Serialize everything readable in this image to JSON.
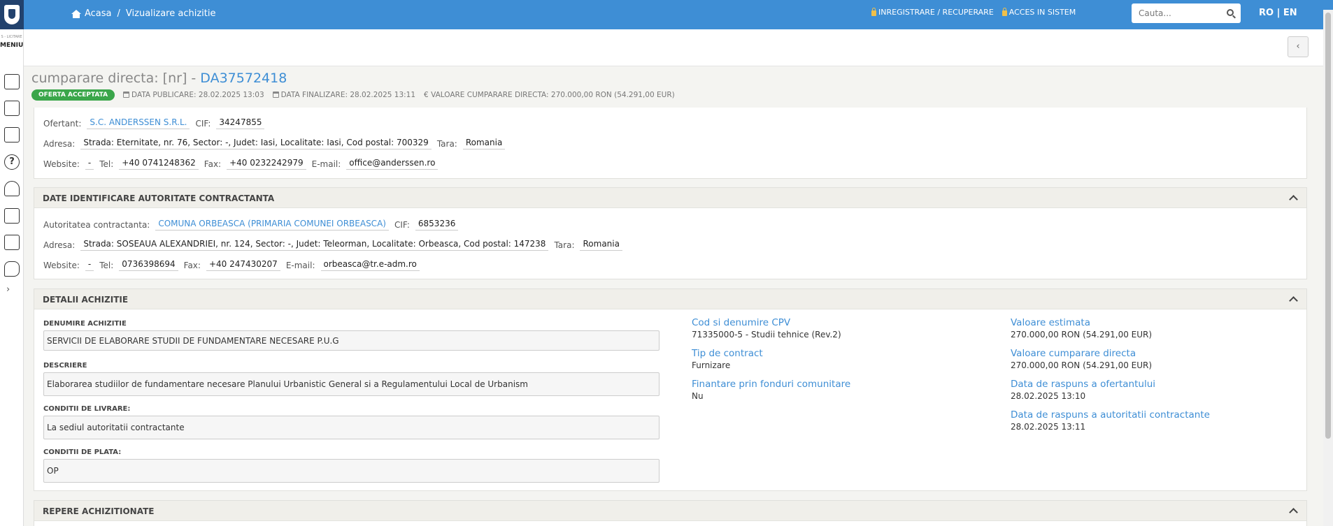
{
  "header": {
    "breadcrumb": {
      "home": "Acasa",
      "separator": "/",
      "current": "Vizualizare achizitie"
    },
    "links": {
      "register": "INREGISTRARE / RECUPERARE",
      "login": "ACCES IN SISTEM"
    },
    "search": {
      "placeholder": "Cauta..."
    },
    "lang": "RO | EN"
  },
  "sidebar": {
    "tiny_label": "S - LICITARE",
    "menu_label": "MENIU"
  },
  "title": {
    "prefix": "cumparare directa: [nr] - ",
    "code": "DA37572418"
  },
  "meta": {
    "badge": "OFERTA ACCEPTATA",
    "published": "DATA PUBLICARE: 28.02.2025 13:03",
    "finalized": "DATA FINALIZARE: 28.02.2025 13:11",
    "value": "€ VALOARE CUMPARARE DIRECTA: 270.000,00  RON (54.291,00  EUR)"
  },
  "ofertant": {
    "label": "Ofertant:",
    "name": "S.C. ANDERSSEN S.R.L.",
    "cif_label": "CIF:",
    "cif": "34247855",
    "address_label": "Adresa:",
    "address": "Strada: Eternitate, nr. 76, Sector: -, Judet: Iasi, Localitate: Iasi, Cod postal: 700329",
    "country_label": "Tara:",
    "country": "Romania",
    "website_label": "Website:",
    "website": "-",
    "tel_label": "Tel:",
    "tel": "+40 0741248362",
    "fax_label": "Fax:",
    "fax": "+40 0232242979",
    "email_label": "E-mail:",
    "email": "office@anderssen.ro"
  },
  "autoritate": {
    "heading": "DATE IDENTIFICARE AUTORITATE CONTRACTANTA",
    "label": "Autoritatea contractanta:",
    "name": "COMUNA ORBEASCA (PRIMARIA COMUNEI ORBEASCA)",
    "cif_label": "CIF:",
    "cif": "6853236",
    "address_label": "Adresa:",
    "address": "Strada: SOSEAUA ALEXANDRIEI, nr. 124, Sector: -, Judet: Teleorman, Localitate: Orbeasca, Cod postal: 147238",
    "country_label": "Tara:",
    "country": "Romania",
    "website_label": "Website:",
    "website": "-",
    "tel_label": "Tel:",
    "tel": "0736398694",
    "fax_label": "Fax:",
    "fax": "+40 247430207",
    "email_label": "E-mail:",
    "email": "orbeasca@tr.e-adm.ro"
  },
  "detalii": {
    "heading": "DETALII ACHIZITIE",
    "denumire_label": "DENUMIRE ACHIZITIE",
    "denumire": "SERVICII DE ELABORARE STUDII DE FUNDAMENTARE NECESARE P.U.G",
    "descriere_label": "DESCRIERE",
    "descriere": "Elaborarea studiilor de fundamentare necesare Planului Urbanistic General si a Regulamentului Local de Urbanism",
    "livrare_label": "CONDITII DE LIVRARE:",
    "livrare": "La sediul autoritatii contractante",
    "plata_label": "CONDITII DE PLATA:",
    "plata": "OP",
    "cpv_label": "Cod si denumire CPV",
    "cpv": "71335000-5 - Studii tehnice (Rev.2)",
    "tip_label": "Tip de contract",
    "tip": "Furnizare",
    "fonduri_label": "Finantare prin fonduri comunitare",
    "fonduri": "Nu",
    "val_est_label": "Valoare estimata",
    "val_est": "270.000,00  RON (54.291,00  EUR)",
    "val_cd_label": "Valoare cumparare directa",
    "val_cd": "270.000,00  RON (54.291,00  EUR)",
    "rasp_of_label": "Data de raspuns a ofertantului",
    "rasp_of": "28.02.2025 13:10",
    "rasp_aut_label": "Data de raspuns a autoritatii contractante",
    "rasp_aut": "28.02.2025 13:11"
  },
  "repere": {
    "heading": "REPERE ACHIZITIONATE"
  }
}
